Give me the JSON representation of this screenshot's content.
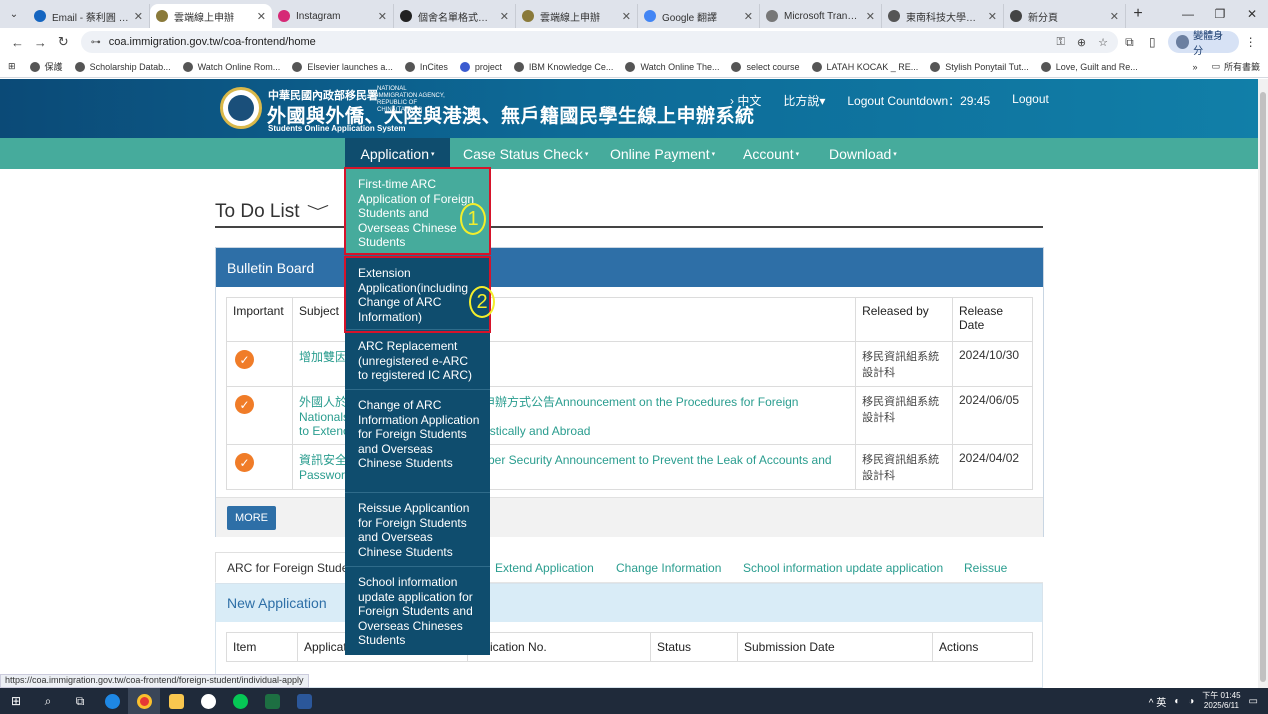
{
  "browser": {
    "tabs": [
      {
        "label": "Email - 蔡利圓 - Outl",
        "color": "#1565c0",
        "active": false
      },
      {
        "label": "雲端線上申辦",
        "color": "#8a7a3a",
        "active": true
      },
      {
        "label": "Instagram",
        "color": "#d62976",
        "active": false
      },
      {
        "label": "個舍名單格式優化",
        "color": "#222222",
        "active": false
      },
      {
        "label": "雲端線上申辦",
        "color": "#8a7a3a",
        "active": false
      },
      {
        "label": "Google 翻譯",
        "color": "#4285f4",
        "active": false
      },
      {
        "label": "Microsoft Translator",
        "color": "#777777",
        "active": false
      },
      {
        "label": "東南科技大學官方網站",
        "color": "#555555",
        "active": false
      },
      {
        "label": "新分頁",
        "color": "#444444",
        "active": false
      }
    ],
    "url": "coa.immigration.gov.tw/coa-frontend/home",
    "profile_label": "變體身分",
    "bookmarks": [
      "保護",
      "Scholarship Datab...",
      "Watch Online Rom...",
      "Elsevier launches a...",
      "InCites",
      "project",
      "IBM Knowledge Ce...",
      "Watch Online The...",
      "select course",
      "LATAH KOCAK _ RE...",
      "Stylish Ponytail Tut...",
      "Love, Guilt and Re..."
    ],
    "bookmarks_more": "»",
    "bookmarks_folder": "所有書籤",
    "status_url": "https://coa.immigration.gov.tw/coa-frontend/foreign-student/individual-apply"
  },
  "header": {
    "agency_zh": "中華民國內政部移民署",
    "agency_en": "NATIONAL IMMIGRATION AGENCY, REPUBLIC OF CHINA(TAIWAN)",
    "title": "外國與外僑、大陸與港澳、無戶籍國民學生線上申辦系統",
    "subtitle": "Students Online Application System",
    "links": [
      "› 中文",
      "比方說▾",
      "Logout Countdown：29:45",
      "Logout"
    ]
  },
  "nav": [
    {
      "label": "Application",
      "open": true
    },
    {
      "label": "Case Status Check",
      "open": false
    },
    {
      "label": "Online Payment",
      "open": false
    },
    {
      "label": "Account",
      "open": false
    },
    {
      "label": "Download",
      "open": false
    }
  ],
  "nav_caret": "▾",
  "dropdown": [
    "First-time ARC Application of Foreign Students and Overseas Chinese Students",
    "Extension Application(including Change of ARC Information)",
    "ARC Replacement (unregistered e-ARC to registered IC ARC)",
    "Change of ARC Information Application for Foreign Students and Overseas Chinese Students",
    "Reissue Applicantion for Foreign Students and Overseas Chinese Students",
    "School information update application for Foreign Students and Overseas Chineses Students"
  ],
  "annotations": [
    "1",
    "2"
  ],
  "todo": {
    "title": "To Do List",
    "chevron": "﹀"
  },
  "bulletin": {
    "title": "Bulletin Board",
    "headers": [
      "Important",
      "Subject",
      "Released by",
      "Release Date"
    ],
    "rows": [
      {
        "subject": "增加雙因子認證 Two-factor authentication added",
        "subject_visible": "增加雙因 ... ntication added",
        "released_by": "移民資訊組系統設計科",
        "date": "2024/10/30"
      },
      {
        "subject_visible_a": "外國人於",
        "subject_visible_b": "家申辦方式公告Announcement on the Procedures for Foreign Nationals",
        "subject_visible_c": "to Extenc",
        "subject_visible_d": "estically and Abroad",
        "released_by": "移民資訊組系統設計科",
        "date": "2024/06/05"
      },
      {
        "subject_visible_a": "資訊安全",
        "subject_visible_b": "yber Security Announcement to Prevent the Leak of Accounts and",
        "subject_visible_c": "Passworc",
        "released_by": "移民資訊組系統設計科",
        "date": "2024/04/02"
      }
    ],
    "more_label": "MORE"
  },
  "app_tabs": [
    "ARC for Foreign Studen",
    "Extend Application",
    "Change Information",
    "School information update application",
    "Reissue"
  ],
  "new_application": {
    "title": "New Application",
    "headers": [
      "Item",
      "Applicat",
      "pplication No.",
      "Status",
      "Submission Date",
      "Actions"
    ]
  },
  "taskbar": {
    "tray": "^ 英",
    "time": "下午 01:45",
    "date": "2025/6/11"
  },
  "colors": {
    "nav_bg": "#46ab9c",
    "dropdown_bg": "#0f4d6e",
    "panel_head": "#2e6fa7",
    "annotation_box": "#d6132a",
    "annotation_number": "#f3ee2c",
    "check": "#f07c28"
  }
}
